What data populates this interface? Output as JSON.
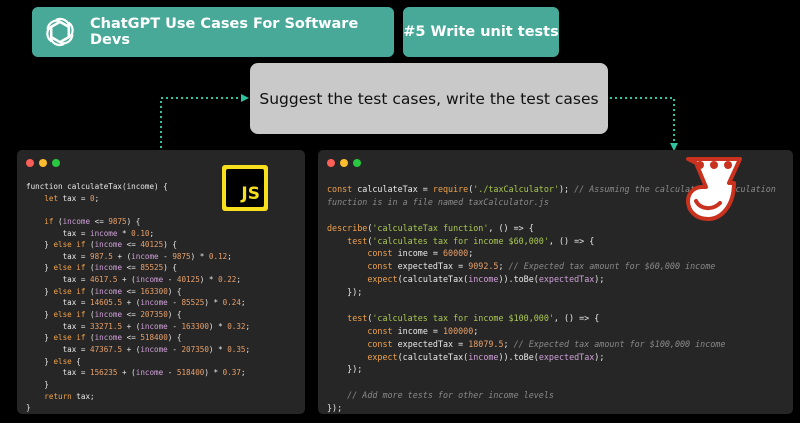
{
  "header": {
    "title": "ChatGPT Use Cases For Software Devs",
    "tag": "#5 Write unit tests",
    "accent": "#48a999"
  },
  "prompt_box": {
    "text": "Suggest the test cases, write the test cases",
    "background": "#c9c9c9"
  },
  "connector_color": "#2ec4a0",
  "left_panel": {
    "logo_text": "JS",
    "lines": [
      [
        [
          "f",
          "function calculateTax(income) {"
        ]
      ],
      [
        [
          "f",
          "    "
        ],
        [
          "k",
          "let"
        ],
        [
          "f",
          " tax = "
        ],
        [
          "n",
          "0"
        ],
        [
          "f",
          ";"
        ]
      ],
      [
        [
          "f",
          " "
        ]
      ],
      [
        [
          "f",
          "    "
        ],
        [
          "k",
          "if"
        ],
        [
          "f",
          " ("
        ],
        [
          "v",
          "income"
        ],
        [
          "f",
          " <= "
        ],
        [
          "n",
          "9875"
        ],
        [
          "f",
          ") {"
        ]
      ],
      [
        [
          "f",
          "        tax = "
        ],
        [
          "v",
          "income"
        ],
        [
          "f",
          " * "
        ],
        [
          "n",
          "0.10"
        ],
        [
          "f",
          ";"
        ]
      ],
      [
        [
          "f",
          "    } "
        ],
        [
          "k",
          "else if"
        ],
        [
          "f",
          " ("
        ],
        [
          "v",
          "income"
        ],
        [
          "f",
          " <= "
        ],
        [
          "n",
          "40125"
        ],
        [
          "f",
          ") {"
        ]
      ],
      [
        [
          "f",
          "        tax = "
        ],
        [
          "n",
          "987.5"
        ],
        [
          "f",
          " + ("
        ],
        [
          "v",
          "income"
        ],
        [
          "f",
          " - "
        ],
        [
          "n",
          "9875"
        ],
        [
          "f",
          ") * "
        ],
        [
          "n",
          "0.12"
        ],
        [
          "f",
          ";"
        ]
      ],
      [
        [
          "f",
          "    } "
        ],
        [
          "k",
          "else if"
        ],
        [
          "f",
          " ("
        ],
        [
          "v",
          "income"
        ],
        [
          "f",
          " <= "
        ],
        [
          "n",
          "85525"
        ],
        [
          "f",
          ") {"
        ]
      ],
      [
        [
          "f",
          "        tax = "
        ],
        [
          "n",
          "4617.5"
        ],
        [
          "f",
          " + ("
        ],
        [
          "v",
          "income"
        ],
        [
          "f",
          " - "
        ],
        [
          "n",
          "40125"
        ],
        [
          "f",
          ") * "
        ],
        [
          "n",
          "0.22"
        ],
        [
          "f",
          ";"
        ]
      ],
      [
        [
          "f",
          "    } "
        ],
        [
          "k",
          "else if"
        ],
        [
          "f",
          " ("
        ],
        [
          "v",
          "income"
        ],
        [
          "f",
          " <= "
        ],
        [
          "n",
          "163300"
        ],
        [
          "f",
          ") {"
        ]
      ],
      [
        [
          "f",
          "        tax = "
        ],
        [
          "n",
          "14605.5"
        ],
        [
          "f",
          " + ("
        ],
        [
          "v",
          "income"
        ],
        [
          "f",
          " - "
        ],
        [
          "n",
          "85525"
        ],
        [
          "f",
          ") * "
        ],
        [
          "n",
          "0.24"
        ],
        [
          "f",
          ";"
        ]
      ],
      [
        [
          "f",
          "    } "
        ],
        [
          "k",
          "else if"
        ],
        [
          "f",
          " ("
        ],
        [
          "v",
          "income"
        ],
        [
          "f",
          " <= "
        ],
        [
          "n",
          "207350"
        ],
        [
          "f",
          ") {"
        ]
      ],
      [
        [
          "f",
          "        tax = "
        ],
        [
          "n",
          "33271.5"
        ],
        [
          "f",
          " + ("
        ],
        [
          "v",
          "income"
        ],
        [
          "f",
          " - "
        ],
        [
          "n",
          "163300"
        ],
        [
          "f",
          ") * "
        ],
        [
          "n",
          "0.32"
        ],
        [
          "f",
          ";"
        ]
      ],
      [
        [
          "f",
          "    } "
        ],
        [
          "k",
          "else if"
        ],
        [
          "f",
          " ("
        ],
        [
          "v",
          "income"
        ],
        [
          "f",
          " <= "
        ],
        [
          "n",
          "518400"
        ],
        [
          "f",
          ") {"
        ]
      ],
      [
        [
          "f",
          "        tax = "
        ],
        [
          "n",
          "47367.5"
        ],
        [
          "f",
          " + ("
        ],
        [
          "v",
          "income"
        ],
        [
          "f",
          " - "
        ],
        [
          "n",
          "207350"
        ],
        [
          "f",
          ") * "
        ],
        [
          "n",
          "0.35"
        ],
        [
          "f",
          ";"
        ]
      ],
      [
        [
          "f",
          "    } "
        ],
        [
          "k",
          "else"
        ],
        [
          "f",
          " {"
        ]
      ],
      [
        [
          "f",
          "        tax = "
        ],
        [
          "n",
          "156235"
        ],
        [
          "f",
          " + ("
        ],
        [
          "v",
          "income"
        ],
        [
          "f",
          " - "
        ],
        [
          "n",
          "518400"
        ],
        [
          "f",
          ") * "
        ],
        [
          "n",
          "0.37"
        ],
        [
          "f",
          ";"
        ]
      ],
      [
        [
          "f",
          "    }"
        ]
      ],
      [
        [
          "f",
          "    "
        ],
        [
          "k",
          "return"
        ],
        [
          "f",
          " tax;"
        ]
      ],
      [
        [
          "f",
          "}"
        ]
      ]
    ]
  },
  "right_panel": {
    "lines": [
      [
        [
          "k",
          "const"
        ],
        [
          "f",
          " calculateTax = "
        ],
        [
          "k",
          "require"
        ],
        [
          "f",
          "("
        ],
        [
          "s",
          "'./taxCalculator'"
        ],
        [
          "f",
          "); "
        ],
        [
          "c",
          "// Assuming the calculateTax calculation"
        ]
      ],
      [
        [
          "c",
          "function is in a file named taxCalculator.js"
        ]
      ],
      [
        [
          "f",
          " "
        ]
      ],
      [
        [
          "k",
          "describe"
        ],
        [
          "f",
          "("
        ],
        [
          "s",
          "'calculateTax function'"
        ],
        [
          "f",
          ", () => {"
        ]
      ],
      [
        [
          "f",
          "    "
        ],
        [
          "k",
          "test"
        ],
        [
          "f",
          "("
        ],
        [
          "s",
          "'calculates tax for income $60,000'"
        ],
        [
          "f",
          ", () => {"
        ]
      ],
      [
        [
          "f",
          "        "
        ],
        [
          "k",
          "const"
        ],
        [
          "f",
          " income = "
        ],
        [
          "n",
          "60000"
        ],
        [
          "f",
          ";"
        ]
      ],
      [
        [
          "f",
          "        "
        ],
        [
          "k",
          "const"
        ],
        [
          "f",
          " expectedTax = "
        ],
        [
          "n",
          "9092.5"
        ],
        [
          "f",
          "; "
        ],
        [
          "c",
          "// Expected tax amount for $60,000 income"
        ]
      ],
      [
        [
          "f",
          "        "
        ],
        [
          "k",
          "expect"
        ],
        [
          "f",
          "(calculateTax("
        ],
        [
          "v",
          "income"
        ],
        [
          "f",
          ")).toBe("
        ],
        [
          "v",
          "expectedTax"
        ],
        [
          "f",
          ");"
        ]
      ],
      [
        [
          "f",
          "    });"
        ]
      ],
      [
        [
          "f",
          " "
        ]
      ],
      [
        [
          "f",
          "    "
        ],
        [
          "k",
          "test"
        ],
        [
          "f",
          "("
        ],
        [
          "s",
          "'calculates tax for income $100,000'"
        ],
        [
          "f",
          ", () => {"
        ]
      ],
      [
        [
          "f",
          "        "
        ],
        [
          "k",
          "const"
        ],
        [
          "f",
          " income = "
        ],
        [
          "n",
          "100000"
        ],
        [
          "f",
          ";"
        ]
      ],
      [
        [
          "f",
          "        "
        ],
        [
          "k",
          "const"
        ],
        [
          "f",
          " expectedTax = "
        ],
        [
          "n",
          "18079.5"
        ],
        [
          "f",
          "; "
        ],
        [
          "c",
          "// Expected tax amount for $100,000 income"
        ]
      ],
      [
        [
          "f",
          "        "
        ],
        [
          "k",
          "expect"
        ],
        [
          "f",
          "(calculateTax("
        ],
        [
          "v",
          "income"
        ],
        [
          "f",
          ")).toBe("
        ],
        [
          "v",
          "expectedTax"
        ],
        [
          "f",
          ");"
        ]
      ],
      [
        [
          "f",
          "    });"
        ]
      ],
      [
        [
          "f",
          " "
        ]
      ],
      [
        [
          "f",
          "    "
        ],
        [
          "c",
          "// Add more tests for other income levels"
        ]
      ],
      [
        [
          "f",
          "});"
        ]
      ]
    ]
  }
}
